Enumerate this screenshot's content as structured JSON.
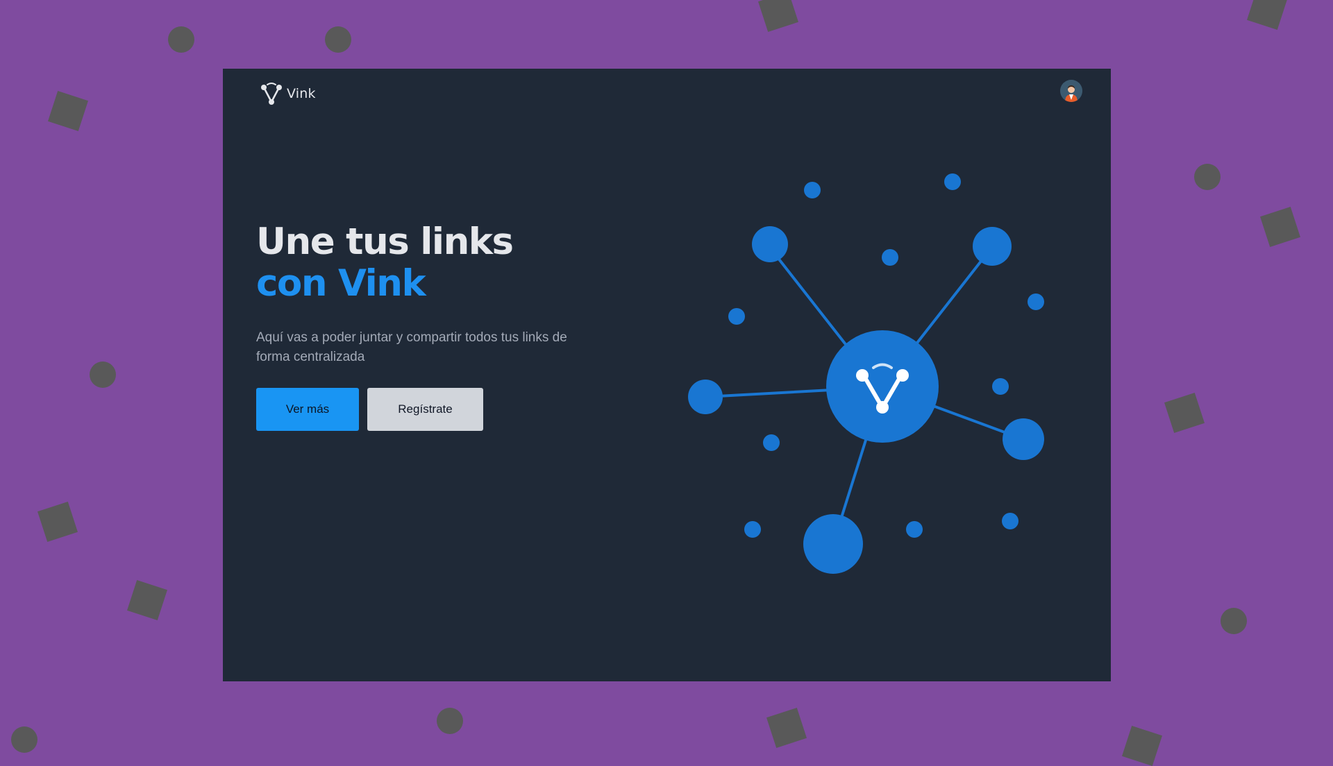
{
  "navbar": {
    "brand_name": "Vink",
    "logo_icon": "vink-logo-icon",
    "avatar_icon": "user-avatar-icon"
  },
  "hero": {
    "title_line1": "Une tus links",
    "title_line2": "con Vink",
    "description": "Aquí vas a poder juntar y compartir todos tus links de forma centralizada"
  },
  "actions": {
    "primary_label": "Ver más",
    "secondary_label": "Regístrate"
  },
  "illustration": {
    "icon": "link-network-illustration",
    "center_icon": "vink-logo-icon"
  },
  "colors": {
    "page_background": "#7f4b9f",
    "window_background": "#1f2937",
    "accent": "#1e90f0",
    "node_blue": "#1976d2",
    "decor_shapes": "#595959",
    "secondary_button": "#d1d5db"
  }
}
